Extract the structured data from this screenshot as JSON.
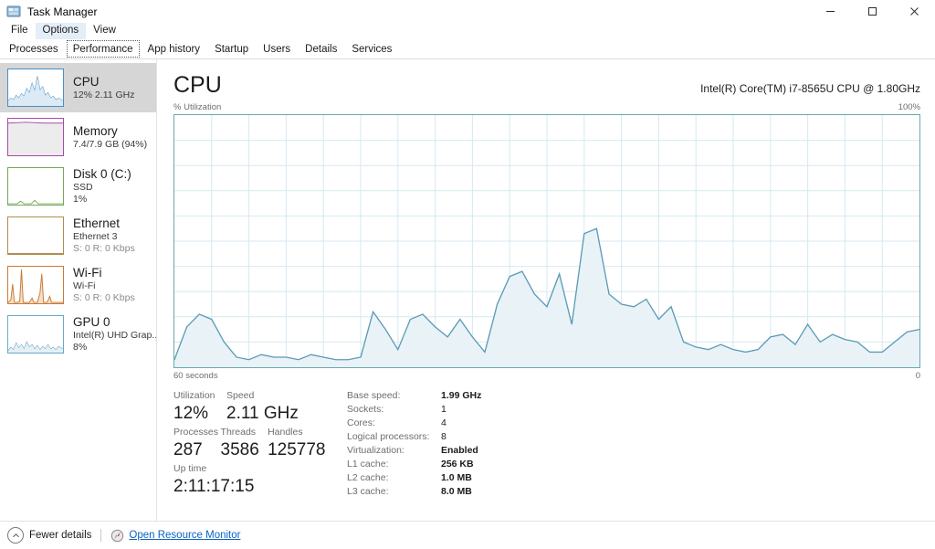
{
  "window": {
    "title": "Task Manager",
    "icon": "task-manager-icon",
    "minimize": "–",
    "maximize": "□",
    "close": "✕"
  },
  "menu": {
    "items": [
      {
        "label": "File",
        "highlighted": false
      },
      {
        "label": "Options",
        "highlighted": true
      },
      {
        "label": "View",
        "highlighted": false
      }
    ]
  },
  "tabs": {
    "items": [
      {
        "label": "Processes",
        "selected": false
      },
      {
        "label": "Performance",
        "selected": true
      },
      {
        "label": "App history",
        "selected": false
      },
      {
        "label": "Startup",
        "selected": false
      },
      {
        "label": "Users",
        "selected": false
      },
      {
        "label": "Details",
        "selected": false
      },
      {
        "label": "Services",
        "selected": false
      }
    ]
  },
  "sidebar": {
    "items": [
      {
        "name": "CPU",
        "line2": "12% 2.11 GHz",
        "line3": "",
        "selected": true,
        "color": "#4b8fc7",
        "fill": "#dbeaf5"
      },
      {
        "name": "Memory",
        "line2": "7.4/7.9 GB (94%)",
        "line3": "",
        "selected": false,
        "color": "#a64ca6",
        "fill": "#ececec"
      },
      {
        "name": "Disk 0 (C:)",
        "line2": "SSD",
        "line3": "1%",
        "selected": false,
        "color": "#76a85c",
        "fill": "#ffffff"
      },
      {
        "name": "Ethernet",
        "line2": "Ethernet 3",
        "line3": "S: 0 R: 0 Kbps",
        "selected": false,
        "color": "#b08d4f",
        "fill": "#ffffff"
      },
      {
        "name": "Wi-Fi",
        "line2": "Wi-Fi",
        "line3": "S: 0 R: 0 Kbps",
        "selected": false,
        "color": "#cc7a33",
        "fill": "#ffffff"
      },
      {
        "name": "GPU 0",
        "line2": "Intel(R) UHD Grap...",
        "line3": "8%",
        "selected": false,
        "color": "#4b8fc7",
        "fill": "#ffffff"
      }
    ]
  },
  "main": {
    "title": "CPU",
    "model": "Intel(R) Core(TM) i7-8565U CPU @ 1.80GHz",
    "graph_top_left_label": "% Utilization",
    "graph_top_right_label": "100%",
    "graph_bottom_left_label": "60 seconds",
    "graph_bottom_right_label": "0"
  },
  "stats": {
    "left": [
      {
        "label": "Utilization",
        "value": "12%"
      },
      {
        "label": "Speed",
        "value": "2.11 GHz"
      },
      {
        "label": "Processes",
        "value": "287"
      },
      {
        "label": "Threads",
        "value": "3586"
      },
      {
        "label": "Handles",
        "value": "125778"
      },
      {
        "label": "Up time",
        "value": "2:11:17:15"
      }
    ],
    "right": [
      {
        "label": "Base speed:",
        "value": "1.99 GHz",
        "bold": true
      },
      {
        "label": "Sockets:",
        "value": "1",
        "bold": false
      },
      {
        "label": "Cores:",
        "value": "4",
        "bold": false
      },
      {
        "label": "Logical processors:",
        "value": "8",
        "bold": false
      },
      {
        "label": "Virtualization:",
        "value": "Enabled",
        "bold": true
      },
      {
        "label": "L1 cache:",
        "value": "256 KB",
        "bold": true
      },
      {
        "label": "L2 cache:",
        "value": "1.0 MB",
        "bold": true
      },
      {
        "label": "L3 cache:",
        "value": "8.0 MB",
        "bold": true
      }
    ]
  },
  "footer": {
    "fewer_details": "Fewer details",
    "open_resource_monitor": "Open Resource Monitor"
  },
  "colors": {
    "graph_line": "#5b9bb5",
    "graph_fill": "#e8f2f7",
    "graph_border": "#6aa9ab",
    "grid": "#d6e9f0",
    "selected_row": "#d6d6d6",
    "link": "#0b63c5"
  },
  "chart_data": {
    "type": "area",
    "title": "CPU % Utilization",
    "xlabel": "60 seconds",
    "ylabel": "% Utilization",
    "ylim": [
      0,
      100
    ],
    "xlim": [
      60,
      0
    ],
    "grid": true,
    "legend": "none",
    "current_value": 12,
    "x": [
      0,
      1,
      2,
      3,
      4,
      5,
      6,
      7,
      8,
      9,
      10,
      11,
      12,
      13,
      14,
      15,
      16,
      17,
      18,
      19,
      20,
      21,
      22,
      23,
      24,
      25,
      26,
      27,
      28,
      29,
      30,
      31,
      32,
      33,
      34,
      35,
      36,
      37,
      38,
      39,
      40,
      41,
      42,
      43,
      44,
      45,
      46,
      47,
      48,
      49,
      50,
      51,
      52,
      53,
      54,
      55,
      56,
      57,
      58,
      59,
      60
    ],
    "values": [
      3,
      16,
      21,
      19,
      10,
      4,
      3,
      5,
      4,
      4,
      3,
      5,
      4,
      3,
      3,
      4,
      22,
      15,
      7,
      19,
      21,
      16,
      12,
      19,
      12,
      6,
      25,
      36,
      38,
      29,
      24,
      37,
      17,
      53,
      55,
      29,
      25,
      24,
      27,
      19,
      24,
      10,
      8,
      7,
      9,
      7,
      6,
      7,
      12,
      13,
      9,
      17,
      10,
      13,
      11,
      10,
      6,
      6,
      10,
      14,
      15
    ]
  }
}
